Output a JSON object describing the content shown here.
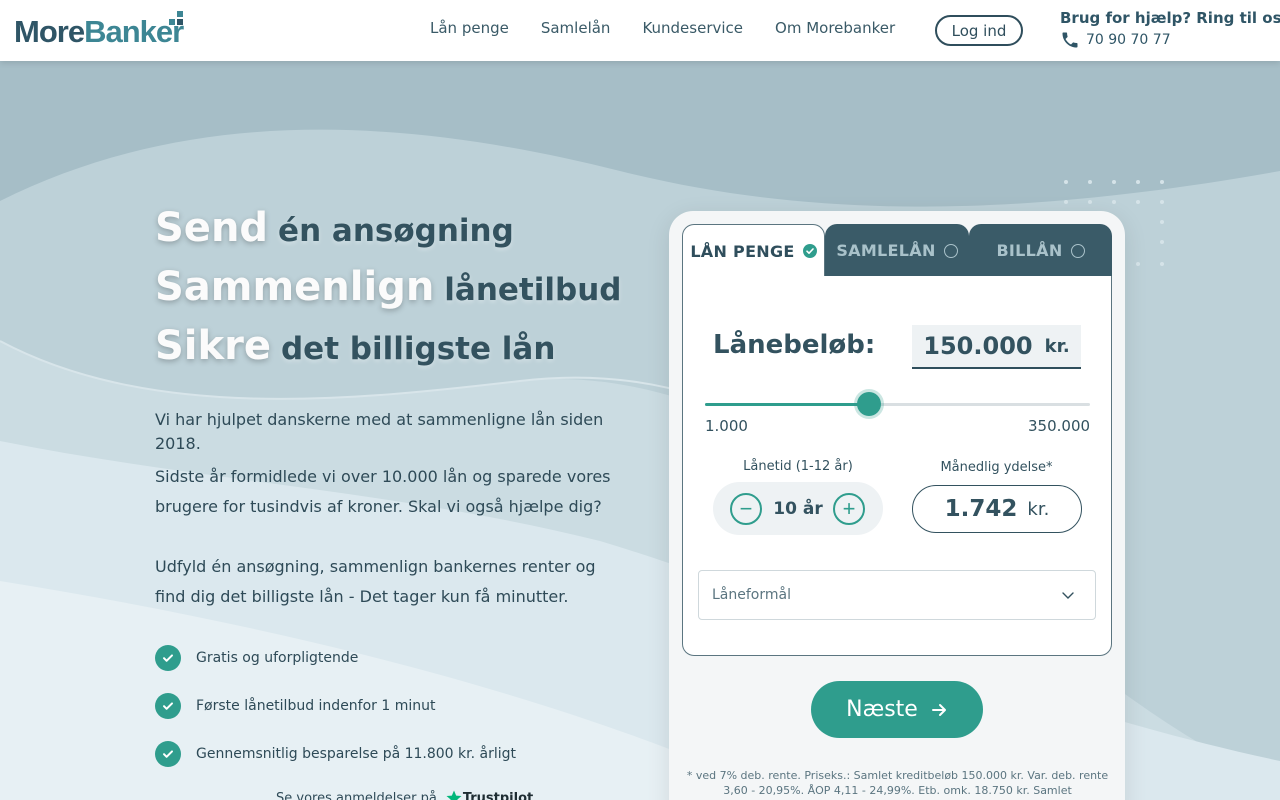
{
  "brand": {
    "logo_part1": "More",
    "logo_part2": "Banker"
  },
  "nav": {
    "items": [
      "Lån penge",
      "Samlelån",
      "Kundeservice",
      "Om Morebanker"
    ],
    "login_label": "Log ind"
  },
  "help": {
    "title": "Brug for hjælp? Ring til os",
    "phone": "70 90 70 77"
  },
  "hero": {
    "lines": [
      {
        "strong": "Send",
        "light": "én ansøgning"
      },
      {
        "strong": "Sammenlign",
        "light": "lånetilbud"
      },
      {
        "strong": "Sikre",
        "light": "det billigste lån"
      }
    ],
    "intro_1": "Vi har hjulpet danskerne med at sammenligne lån siden 2018.",
    "intro_2": "Sidste år formidlede vi over 10.000 lån og sparede vores brugere for tusindvis af kroner. Skal vi også hjælpe dig?",
    "intro_3": "Udfyld én ansøgning, sammenlign bankernes renter og find dig det billigste lån - Det tager kun få minutter.",
    "features": [
      "Gratis og uforpligtende",
      "Første lånetilbud indenfor 1 minut",
      "Gennemsnitlig besparelse på 11.800 kr. årligt"
    ],
    "reviews_text": "Se vores anmeldelser på",
    "reviews_brand": "Trustpilot"
  },
  "calculator": {
    "tabs": [
      {
        "label": "LÅN PENGE",
        "selected": true
      },
      {
        "label": "SAMLELÅN",
        "selected": false
      },
      {
        "label": "BILLÅN",
        "selected": false
      }
    ],
    "amount_label": "Lånebeløb:",
    "amount_value": "150.000",
    "amount_unit": "kr.",
    "slider": {
      "min_label": "1.000",
      "max_label": "350.000",
      "min": 1000,
      "max": 350000,
      "value": 150000
    },
    "term_label": "Lånetid (1-12 år)",
    "term_value": "10 år",
    "term_minus": "−",
    "term_plus": "+",
    "monthly_label": "Månedlig ydelse*",
    "monthly_value": "1.742",
    "monthly_unit": "kr.",
    "purpose_placeholder": "Låneformål",
    "next_label": "Næste",
    "footnote": "* ved 7% deb. rente. Priseks.: Samlet kreditbeløb 150.000 kr. Var. deb. rente 3,60 - 20,95%. ÅOP 4,11 - 24,99%. Etb. omk. 18.750 kr. Samlet tilbagebetalingsbeløb"
  },
  "colors": {
    "accent": "#2f9d8d",
    "dark": "#33525f",
    "tab_inactive": "#3a5b68",
    "background": "#a7bfc8"
  }
}
